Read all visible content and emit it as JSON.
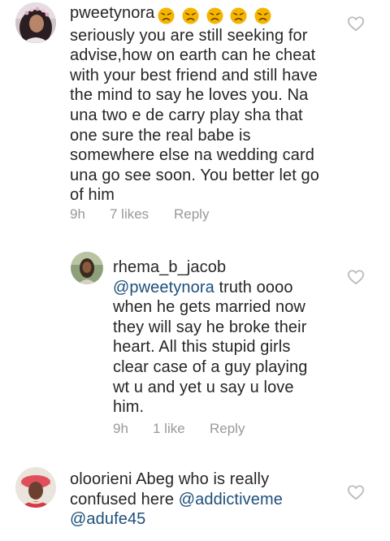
{
  "comments": [
    {
      "username": "pweetynora",
      "emojis": [
        "persevering-face",
        "persevering-face",
        "persevering-face",
        "persevering-face",
        "persevering-face"
      ],
      "lines": [
        "seriously you are still seeking for",
        "advise,how on earth can he cheat",
        "with your best friend and still have",
        "the mind to say he loves you. Na",
        "una two e de carry play sha that",
        "one sure the real babe is",
        "somewhere else na wedding card",
        "una go see soon. You better let go",
        "of him"
      ],
      "time": "9h",
      "likes": "7 likes",
      "reply": "Reply",
      "like_icon": "heart-outline-icon"
    },
    {
      "username": "rhema_b_jacob",
      "mention": "@pweetynora",
      "first_line_rest": " truth oooo",
      "lines": [
        "when he gets married now",
        "they will say he broke their",
        "heart. All this stupid girls",
        "clear case of a guy playing",
        "wt u and yet u say u love",
        "him."
      ],
      "time": "9h",
      "likes": "1 like",
      "reply": "Reply",
      "like_icon": "heart-outline-icon"
    },
    {
      "username": "oloorieni",
      "first_line_rest": " Abeg who is really",
      "second_line_text": "confused here ",
      "mention_1": "@addictiveme",
      "mention_2": "@adufe45",
      "like_icon": "heart-outline-icon"
    }
  ],
  "colors": {
    "text": "#262626",
    "meta": "#999999",
    "mention": "#1d4f7a",
    "heart": "#bbbbbb",
    "emoji": "#f5b400"
  }
}
